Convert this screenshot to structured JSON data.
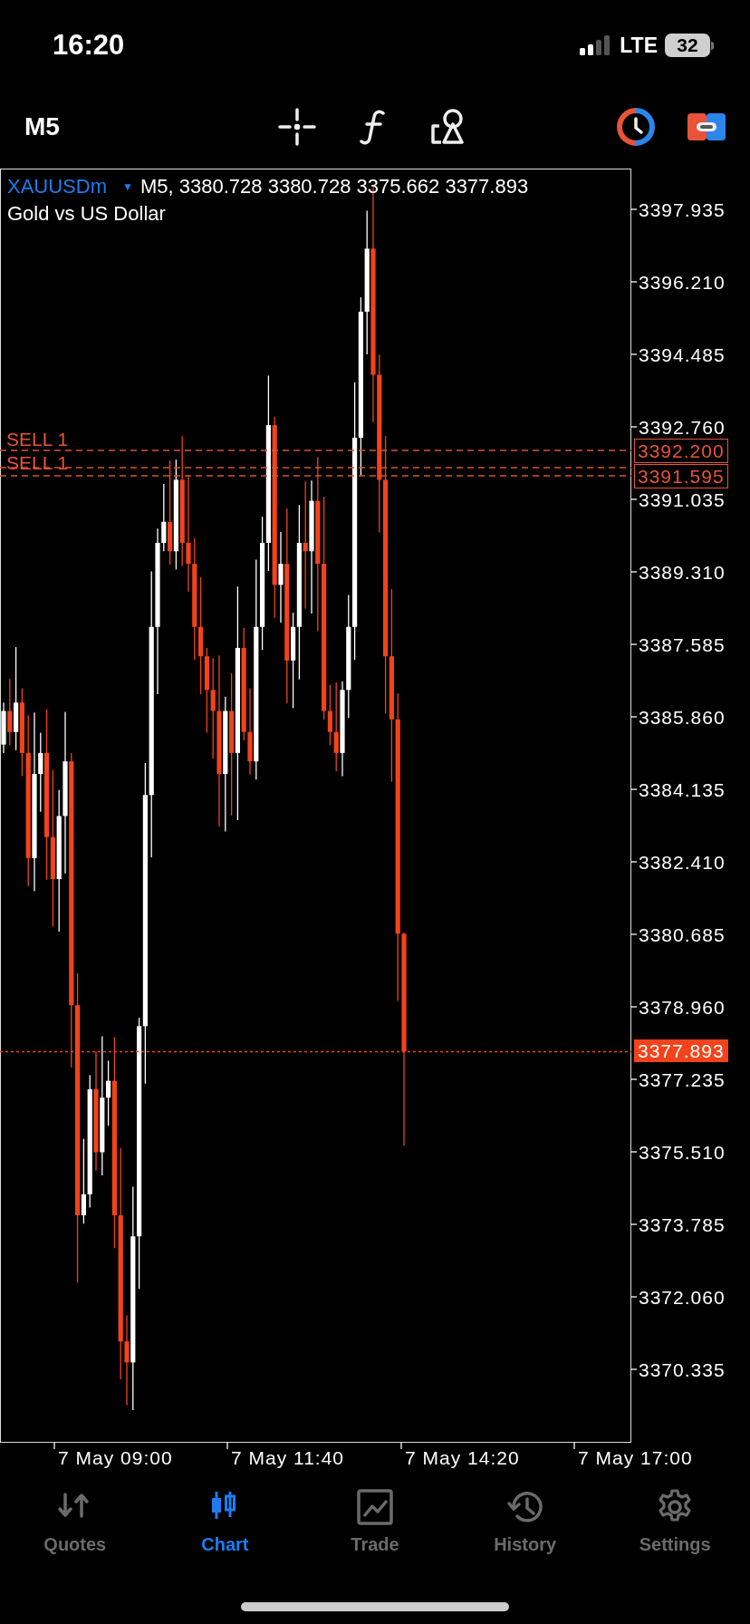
{
  "status_bar": {
    "time": "16:20",
    "network": "LTE",
    "battery": "32"
  },
  "toolbar": {
    "timeframe": "M5"
  },
  "chart": {
    "symbol": "XAUUSDm",
    "symbol_caret": "▼",
    "ohlc": "M5, 3380.728 3380.728 3375.662 3377.893",
    "description": "Gold vs US Dollar",
    "price_labels": [
      "3397.935",
      "3396.210",
      "3394.485",
      "3392.760",
      "3391.035",
      "3389.310",
      "3387.585",
      "3385.860",
      "3384.135",
      "3382.410",
      "3380.685",
      "3378.960",
      "3377.235",
      "3375.510",
      "3373.785",
      "3372.060",
      "3370.335"
    ],
    "order_lines": [
      {
        "label": "SELL 1",
        "price": "3392.200"
      },
      {
        "label": "SELL 1",
        "price": "3391.595"
      }
    ],
    "current_price": "3377.893",
    "time_labels": [
      "7 May 09:00",
      "7 May 11:40",
      "7 May 14:20",
      "7 May 17:00"
    ]
  },
  "tabs": [
    {
      "label": "Quotes",
      "kind": "quotes",
      "selected": false
    },
    {
      "label": "Chart",
      "kind": "chart",
      "selected": true
    },
    {
      "label": "Trade",
      "kind": "trade",
      "selected": false
    },
    {
      "label": "History",
      "kind": "history",
      "selected": false
    },
    {
      "label": "Settings",
      "kind": "settings",
      "selected": false
    }
  ]
}
